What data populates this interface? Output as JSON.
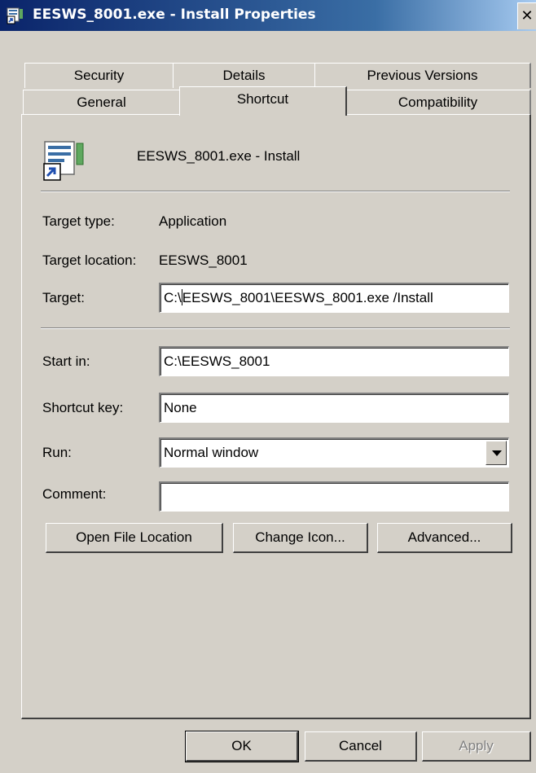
{
  "window": {
    "title": "EESWS_8001.exe - Install Properties",
    "close_glyph": "✕"
  },
  "tabs_row1": [
    {
      "label": "Security"
    },
    {
      "label": "Details"
    },
    {
      "label": "Previous Versions"
    }
  ],
  "tabs_row2": [
    {
      "label": "General"
    },
    {
      "label": "Shortcut",
      "active": true
    },
    {
      "label": "Compatibility"
    }
  ],
  "shortcut": {
    "name": "EESWS_8001.exe - Install",
    "target_type_label": "Target type:",
    "target_type_value": "Application",
    "target_location_label": "Target location:",
    "target_location_value": "EESWS_8001",
    "target_label": "Target:",
    "target_prefix": "C:\\",
    "target_suffix": "EESWS_8001\\EESWS_8001.exe /Install",
    "start_in_label": "Start in:",
    "start_in_value": "C:\\EESWS_8001",
    "shortcut_key_label": "Shortcut key:",
    "shortcut_key_value": "None",
    "run_label": "Run:",
    "run_value": "Normal window",
    "comment_label": "Comment:",
    "comment_value": ""
  },
  "buttons": {
    "open_file_location": "Open File Location",
    "change_icon": "Change Icon...",
    "advanced": "Advanced...",
    "ok": "OK",
    "cancel": "Cancel",
    "apply": "Apply"
  },
  "icons": {
    "title": "shortcut-app-icon",
    "app": "shortcut-app-icon",
    "dropdown": "chevron-down-icon"
  }
}
